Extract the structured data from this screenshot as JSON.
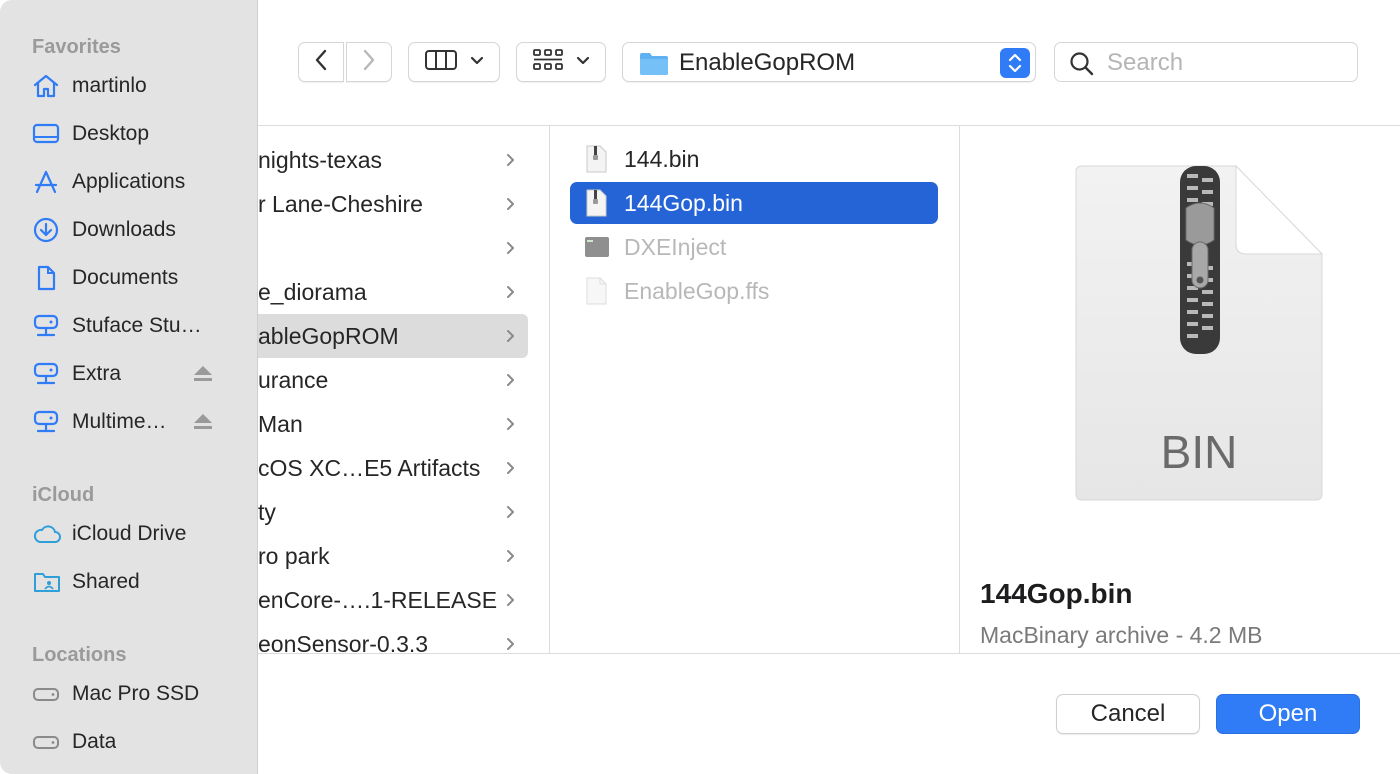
{
  "sidebar": {
    "sections": {
      "favorites": "Favorites",
      "icloud": "iCloud",
      "locations": "Locations"
    },
    "favorites": [
      {
        "label": "martinlo",
        "icon": "home-icon"
      },
      {
        "label": "Desktop",
        "icon": "desktop-icon"
      },
      {
        "label": "Applications",
        "icon": "applications-icon"
      },
      {
        "label": "Downloads",
        "icon": "downloads-icon"
      },
      {
        "label": "Documents",
        "icon": "documents-icon"
      },
      {
        "label": "Stuface Stu…",
        "icon": "network-drive-icon"
      },
      {
        "label": "Extra",
        "icon": "network-drive-icon",
        "eject": true
      },
      {
        "label": "Multime…",
        "icon": "network-drive-icon",
        "eject": true
      }
    ],
    "icloud": [
      {
        "label": "iCloud Drive",
        "icon": "cloud-icon"
      },
      {
        "label": "Shared",
        "icon": "shared-folder-icon"
      }
    ],
    "locations": [
      {
        "label": "Mac Pro SSD",
        "icon": "disk-icon"
      },
      {
        "label": "Data",
        "icon": "disk-icon"
      }
    ]
  },
  "toolbar": {
    "path": "EnableGopROM",
    "search_placeholder": "Search"
  },
  "column1": [
    {
      "label": "nights-texas"
    },
    {
      "label": "r Lane-Cheshire"
    },
    {
      "label": ""
    },
    {
      "label": "e_diorama"
    },
    {
      "label": "ableGopROM",
      "selected": true
    },
    {
      "label": "urance"
    },
    {
      "label": "Man"
    },
    {
      "label": "cOS XC…E5 Artifacts"
    },
    {
      "label": "ty"
    },
    {
      "label": "ro park"
    },
    {
      "label": "enCore-….1-RELEASE"
    },
    {
      "label": "eonSensor-0.3.3"
    }
  ],
  "column2": [
    {
      "label": "144.bin",
      "state": "normal",
      "icon": "document-zip-icon"
    },
    {
      "label": "144Gop.bin",
      "state": "selected",
      "icon": "document-zip-icon"
    },
    {
      "label": "DXEInject",
      "state": "disabled",
      "icon": "terminal-exec-icon"
    },
    {
      "label": "EnableGop.ffs",
      "state": "disabled",
      "icon": "blank-document-icon"
    }
  ],
  "preview": {
    "icon_text": "BIN",
    "name": "144Gop.bin",
    "kind": "MacBinary archive - 4.2 MB"
  },
  "buttons": {
    "cancel": "Cancel",
    "open": "Open"
  },
  "colors": {
    "accent": "#2f7cf6",
    "selection": "#2464d6",
    "sidebar_icon": "#2f7cf6",
    "sidebar_bg": "#e3e3e3"
  }
}
